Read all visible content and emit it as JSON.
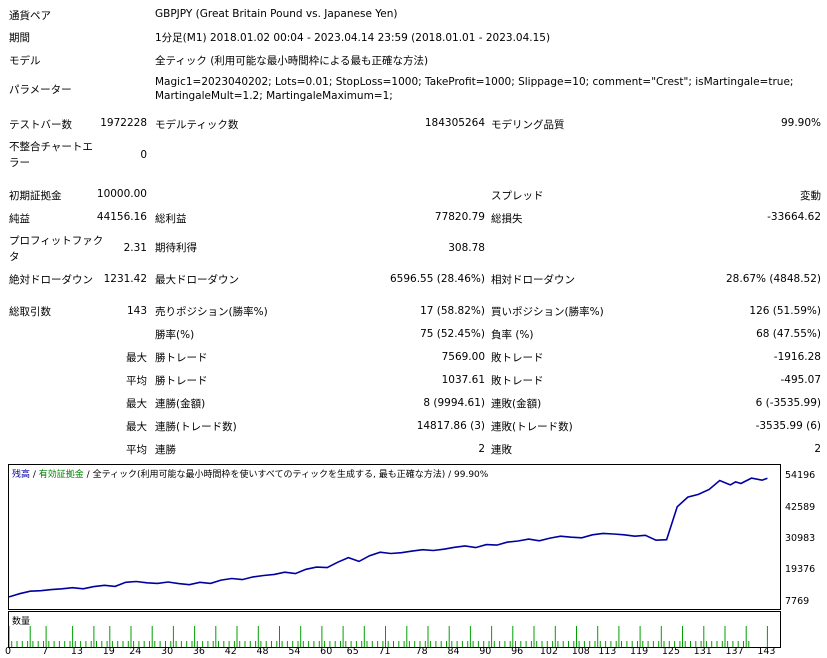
{
  "report": {
    "symbol_label": "通貨ペア",
    "symbol_value": "GBPJPY (Great Britain Pound vs. Japanese Yen)",
    "period_label": "期間",
    "period_value": "1分足(M1) 2018.01.02 00:04 - 2023.04.14 23:59 (2018.01.01 - 2023.04.15)",
    "model_label": "モデル",
    "model_value": "全ティック (利用可能な最小時間枠による最も正確な方法)",
    "params_label": "パラメーター",
    "params_line1": "Magic1=2023040202; Lots=0.01; StopLoss=1000; TakeProfit=1000; Slippage=10; comment=\"Crest\"; isMartingale=true;",
    "params_line2": "MartingaleMult=1.2; MartingaleMaximum=1;",
    "bars_label": "テストバー数",
    "bars_value": "1972228",
    "ticks_label": "モデルティック数",
    "ticks_value": "184305264",
    "quality_label": "モデリング品質",
    "quality_value": "99.90%",
    "mismatch_label_1": "不整合チャートエ",
    "mismatch_label_2": "ラー",
    "mismatch_value": "0",
    "deposit_label": "初期証拠金",
    "deposit_value": "10000.00",
    "spread_label": "スプレッド",
    "spread_value": "変動",
    "net_label": "純益",
    "net_value": "44156.16",
    "gross_profit_label": "総利益",
    "gross_profit_value": "77820.79",
    "gross_loss_label": "総損失",
    "gross_loss_value": "-33664.62",
    "pf_label_1": "プロフィットファク",
    "pf_label_2": "タ",
    "pf_value": "2.31",
    "expected_label": "期待利得",
    "expected_value": "308.78",
    "abs_dd_label": "絶対ドローダウン",
    "abs_dd_value": "1231.42",
    "max_dd_label": "最大ドローダウン",
    "max_dd_value": "6596.55 (28.46%)",
    "rel_dd_label": "相対ドローダウン",
    "rel_dd_value": "28.67% (4848.52)",
    "trades_label": "総取引数",
    "trades_value": "143",
    "short_label": "売りポジション(勝率%)",
    "short_value": "17 (58.82%)",
    "long_label": "買いポジション(勝率%)",
    "long_value": "126 (51.59%)",
    "win_rate_label": "勝率(%)",
    "win_rate_value": "75 (52.45%)",
    "loss_rate_label": "負率 (%)",
    "loss_rate_value": "68 (47.55%)",
    "max_word": "最大",
    "avg_word": "平均",
    "largest_win_label": "勝トレード",
    "largest_win_value": "7569.00",
    "largest_loss_label": "敗トレード",
    "largest_loss_value": "-1916.28",
    "avg_win_label": "勝トレード",
    "avg_win_value": "1037.61",
    "avg_loss_label": "敗トレード",
    "avg_loss_value": "-495.07",
    "max_cons_wins_label": "連勝(金額)",
    "max_cons_wins_value": "8 (9994.61)",
    "max_cons_losses_label": "連敗(金額)",
    "max_cons_losses_value": "6 (-3535.99)",
    "max_cons_profit_label": "連勝(トレード数)",
    "max_cons_profit_value": "14817.86 (3)",
    "max_cons_loss_label": "連敗(トレード数)",
    "max_cons_loss_value": "-3535.99 (6)",
    "avg_cons_wins_label": "連勝",
    "avg_cons_wins_value": "2",
    "avg_cons_losses_label": "連敗",
    "avg_cons_losses_value": "2"
  },
  "chart": {
    "legend_balance": "残高",
    "legend_sep1": " / ",
    "legend_equity": "有効証拠金",
    "legend_sep2": " / ",
    "legend_model": "全ティック(利用可能な最小時間枠を使いすべてのティックを生成する, 最も正確な方法)",
    "legend_sep3": " / ",
    "legend_quality": "99.90%",
    "volume_label": "数量",
    "colors": {
      "balance": "#0000a0",
      "equity": "#008000",
      "volume": "#00a000"
    }
  },
  "chart_data": {
    "type": "line",
    "title": "",
    "xlabel": "",
    "ylabel": "",
    "ylim": [
      7769,
      54196
    ],
    "y_ticks": [
      "54196",
      "42589",
      "30983",
      "19376",
      "7769"
    ],
    "x_ticks": [
      "0",
      "7",
      "13",
      "19",
      "24",
      "30",
      "36",
      "42",
      "48",
      "54",
      "60",
      "65",
      "71",
      "78",
      "84",
      "90",
      "96",
      "102",
      "108",
      "113",
      "119",
      "125",
      "131",
      "137",
      "143"
    ],
    "x_tick_values": [
      0,
      7,
      13,
      19,
      24,
      30,
      36,
      42,
      48,
      54,
      60,
      65,
      71,
      78,
      84,
      90,
      96,
      102,
      108,
      113,
      119,
      125,
      131,
      137,
      143
    ],
    "xlim": [
      0,
      145
    ],
    "series": [
      {
        "x": [
          0,
          2,
          4,
          6,
          8,
          10,
          12,
          14,
          16,
          18,
          20,
          22,
          24,
          26,
          28,
          30,
          32,
          34,
          36,
          38,
          40,
          42,
          44,
          46,
          48,
          50,
          52,
          54,
          56,
          58,
          60,
          62,
          64,
          66,
          68,
          70,
          72,
          74,
          76,
          78,
          80,
          82,
          84,
          86,
          88,
          90,
          92,
          94,
          96,
          98,
          100,
          102,
          104,
          106,
          108,
          110,
          112,
          114,
          116,
          118,
          120,
          122,
          124,
          126,
          128,
          130,
          132,
          134,
          136,
          137,
          138,
          140,
          142,
          143
        ],
        "values": [
          10000,
          11200,
          12100,
          12300,
          12700,
          13000,
          13400,
          13000,
          13800,
          14300,
          13900,
          15400,
          15700,
          15200,
          15000,
          15500,
          14900,
          14500,
          15400,
          15000,
          16200,
          16800,
          16400,
          17400,
          17900,
          18300,
          19100,
          18600,
          20200,
          21000,
          20800,
          22800,
          24500,
          23100,
          25200,
          26500,
          26000,
          26300,
          26900,
          27400,
          27100,
          27600,
          28300,
          28800,
          28200,
          29300,
          29100,
          30200,
          30600,
          31300,
          30700,
          31700,
          32400,
          32000,
          31800,
          32900,
          33400,
          33200,
          32900,
          32400,
          32700,
          30900,
          31100,
          43200,
          46800,
          47800,
          49600,
          52900,
          51300,
          52400,
          51800,
          53800,
          53000,
          53700
        ]
      }
    ],
    "volume_x": [
      0,
      4,
      7,
      12,
      16,
      19,
      23,
      27,
      31,
      35,
      39,
      43,
      47,
      51,
      55,
      59,
      63,
      67,
      71,
      75,
      79,
      83,
      87,
      91,
      95,
      99,
      103,
      107,
      111,
      115,
      119,
      123,
      127,
      131,
      135,
      139,
      143
    ]
  }
}
